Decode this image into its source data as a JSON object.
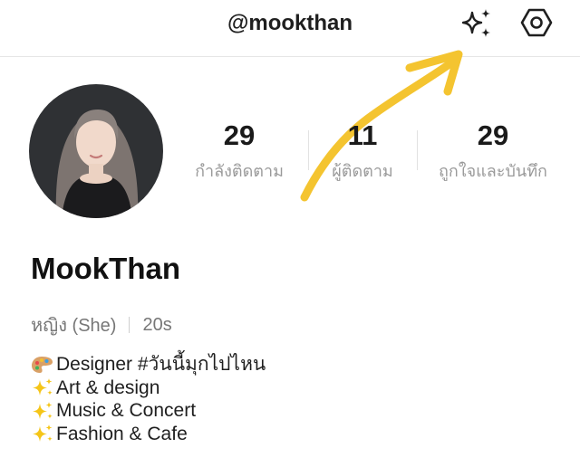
{
  "header": {
    "handle": "@mookthan",
    "sparkle_icon": "sparkles-icon",
    "settings_icon": "hexagon-settings-icon"
  },
  "profile": {
    "avatar": "profile-photo",
    "name": "MookThan",
    "gender": "หญิง (She)",
    "age": "20s"
  },
  "stats": [
    {
      "value": "29",
      "label": "กำลังติดตาม"
    },
    {
      "value": "11",
      "label": "ผู้ติดตาม"
    },
    {
      "value": "29",
      "label": "ถูกใจและบันทึก"
    }
  ],
  "bio": [
    {
      "emoji": "palette-icon",
      "text": "Designer #วันนี้มุกไปไหน"
    },
    {
      "emoji": "sparkles-icon",
      "text": "Art & design"
    },
    {
      "emoji": "sparkles-icon",
      "text": "Music & Concert"
    },
    {
      "emoji": "sparkles-icon",
      "text": "Fashion & Cafe"
    }
  ],
  "colors": {
    "annotation_arrow": "#f4c430",
    "text_primary": "#1a1a1a",
    "text_secondary": "#9a9a9a"
  }
}
